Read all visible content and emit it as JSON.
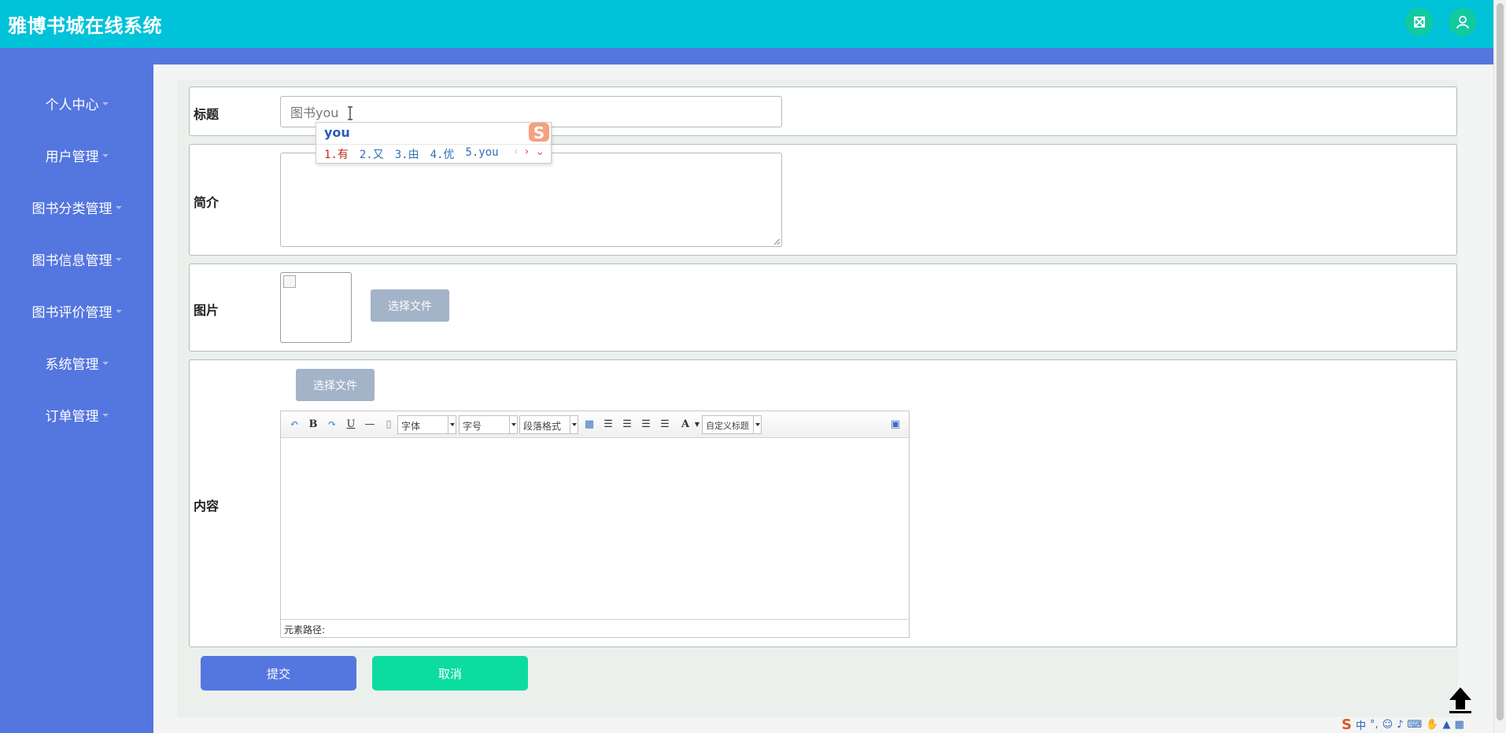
{
  "app": {
    "title": "雅博书城在线系统"
  },
  "header": {
    "fullscreen_icon": "expand-icon",
    "user_icon": "user-icon"
  },
  "sidebar": {
    "items": [
      {
        "label": "个人中心"
      },
      {
        "label": "用户管理"
      },
      {
        "label": "图书分类管理"
      },
      {
        "label": "图书信息管理"
      },
      {
        "label": "图书评价管理"
      },
      {
        "label": "系统管理"
      },
      {
        "label": "订单管理"
      }
    ]
  },
  "form": {
    "title_label": "标题",
    "title_value": "图书you",
    "intro_label": "简介",
    "intro_value": "",
    "image_label": "图片",
    "choose_file": "选择文件",
    "content_label": "内容",
    "content_choose_file": "选择文件",
    "submit": "提交",
    "cancel": "取消"
  },
  "ime": {
    "composition": "you",
    "candidates": [
      "1.有",
      "2.又",
      "3.由",
      "4.优",
      "5.you"
    ]
  },
  "editor": {
    "font_family": "字体",
    "font_size": "字号",
    "paragraph": "段落格式",
    "custom_title": "自定义标题",
    "status": "元素路径:"
  },
  "tray": {
    "ime_mode": "中",
    "punct": "°,"
  },
  "colors": {
    "header": "#00c2d9",
    "sidebar": "#5476df",
    "submit": "#5476df",
    "cancel": "#0cdca0",
    "file_button": "#a3b3c8"
  }
}
